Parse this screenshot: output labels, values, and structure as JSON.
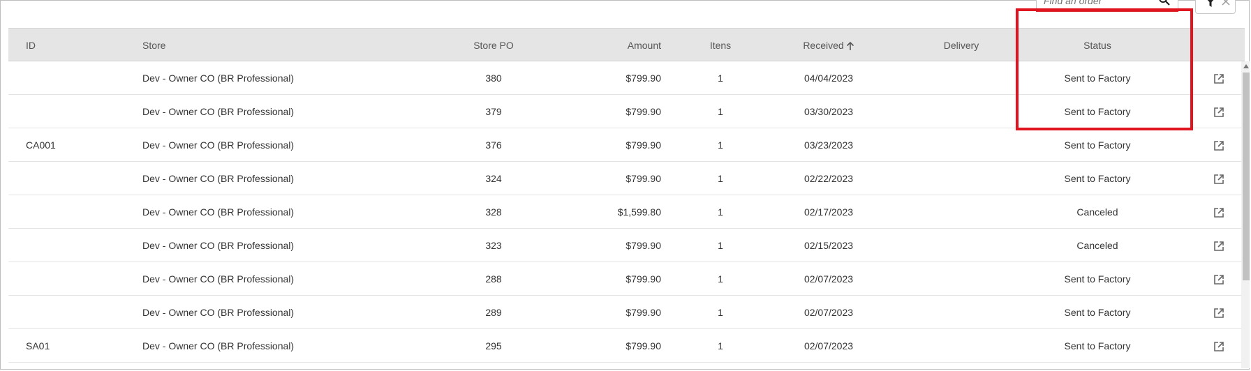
{
  "search": {
    "placeholder": "Find an order"
  },
  "columns": {
    "id": "ID",
    "store": "Store",
    "store_po": "Store PO",
    "amount": "Amount",
    "items": "Itens",
    "received": "Received",
    "delivery": "Delivery",
    "status": "Status"
  },
  "rows": [
    {
      "id": "",
      "store": "Dev - Owner CO (BR Professional)",
      "store_po": "380",
      "amount": "$799.90",
      "items": "1",
      "received": "04/04/2023",
      "delivery": "",
      "status": "Sent to Factory"
    },
    {
      "id": "",
      "store": "Dev - Owner CO (BR Professional)",
      "store_po": "379",
      "amount": "$799.90",
      "items": "1",
      "received": "03/30/2023",
      "delivery": "",
      "status": "Sent to Factory"
    },
    {
      "id": "CA001",
      "store": "Dev - Owner CO (BR Professional)",
      "store_po": "376",
      "amount": "$799.90",
      "items": "1",
      "received": "03/23/2023",
      "delivery": "",
      "status": "Sent to Factory"
    },
    {
      "id": "",
      "store": "Dev - Owner CO (BR Professional)",
      "store_po": "324",
      "amount": "$799.90",
      "items": "1",
      "received": "02/22/2023",
      "delivery": "",
      "status": "Sent to Factory"
    },
    {
      "id": "",
      "store": "Dev - Owner CO (BR Professional)",
      "store_po": "328",
      "amount": "$1,599.80",
      "items": "1",
      "received": "02/17/2023",
      "delivery": "",
      "status": "Canceled"
    },
    {
      "id": "",
      "store": "Dev - Owner CO (BR Professional)",
      "store_po": "323",
      "amount": "$799.90",
      "items": "1",
      "received": "02/15/2023",
      "delivery": "",
      "status": "Canceled"
    },
    {
      "id": "",
      "store": "Dev - Owner CO (BR Professional)",
      "store_po": "288",
      "amount": "$799.90",
      "items": "1",
      "received": "02/07/2023",
      "delivery": "",
      "status": "Sent to Factory"
    },
    {
      "id": "",
      "store": "Dev - Owner CO (BR Professional)",
      "store_po": "289",
      "amount": "$799.90",
      "items": "1",
      "received": "02/07/2023",
      "delivery": "",
      "status": "Sent to Factory"
    },
    {
      "id": "SA01",
      "store": "Dev - Owner CO (BR Professional)",
      "store_po": "295",
      "amount": "$799.90",
      "items": "1",
      "received": "02/07/2023",
      "delivery": "",
      "status": "Sent to Factory"
    }
  ],
  "colors": {
    "accent_red": "#e0141e",
    "header_bg": "#e5e5e5"
  },
  "icons": [
    "search-icon",
    "filter-icon",
    "close-icon",
    "sort-arrow-up-icon",
    "open-external-icon"
  ]
}
